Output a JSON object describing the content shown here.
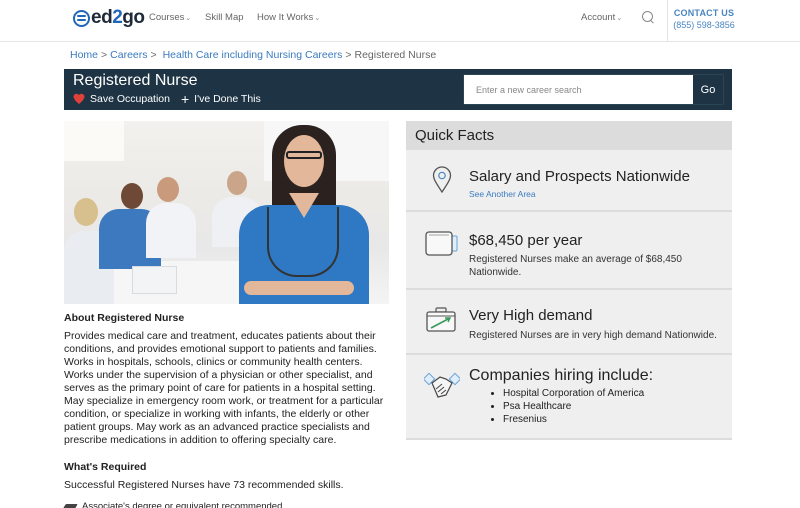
{
  "nav": {
    "logo_prefix": "ed",
    "logo_two": "2",
    "logo_suffix": "go",
    "courses": "Courses",
    "skill_map": "Skill Map",
    "how_it_works": "How It Works",
    "account": "Account",
    "contact_label": "CONTACT US",
    "contact_phone": "(855) 598-3856"
  },
  "breadcrumb": {
    "items": [
      "Home",
      "Careers",
      "Health Care including Nursing Careers"
    ],
    "current": "Registered Nurse",
    "separator": ">"
  },
  "titlebar": {
    "title": "Registered Nurse",
    "save_label": "Save Occupation",
    "done_label": "I've Done This",
    "search_placeholder": "Enter a new career search",
    "go_label": "Go"
  },
  "about": {
    "heading": "About Registered Nurse",
    "text": "Provides medical care and treatment, educates patients about their conditions, and provides emotional support to patients and families. Works in hospitals, schools, clinics or community health centers. Works under the supervision of a physician or other specialist, and serves as the primary point of care for patients in a hospital setting. May specialize in emergency room work, or treatment for a particular condition, or specialize in working with infants, the elderly or other patient groups. May work as an advanced practice specialists and prescribe medications in addition to offering specialty care."
  },
  "required": {
    "heading": "What's Required",
    "text": "Successful Registered Nurses have 73 recommended skills.",
    "degree": "Associate's degree or equivalent recommended"
  },
  "quick_facts": {
    "heading": "Quick Facts",
    "location": {
      "title": "Salary and Prospects Nationwide",
      "link": "See Another Area"
    },
    "salary": {
      "title": "$68,450 per year",
      "text": "Registered Nurses make an average of $68,450 Nationwide."
    },
    "demand": {
      "title": "Very High demand",
      "text": "Registered Nurses are in very high demand Nationwide."
    },
    "companies": {
      "title": "Companies hiring include:",
      "list": [
        "Hospital Corporation of America",
        "Psa Healthcare",
        "Fresenius"
      ]
    }
  },
  "colors": {
    "brand_blue": "#2266b8",
    "link_blue": "#3a7bbf",
    "titlebar_bg": "#1e3444",
    "heart_red": "#e0403a",
    "quickfacts_bg": "#efefef",
    "quickfacts_head_bg": "#dcdcdc"
  }
}
